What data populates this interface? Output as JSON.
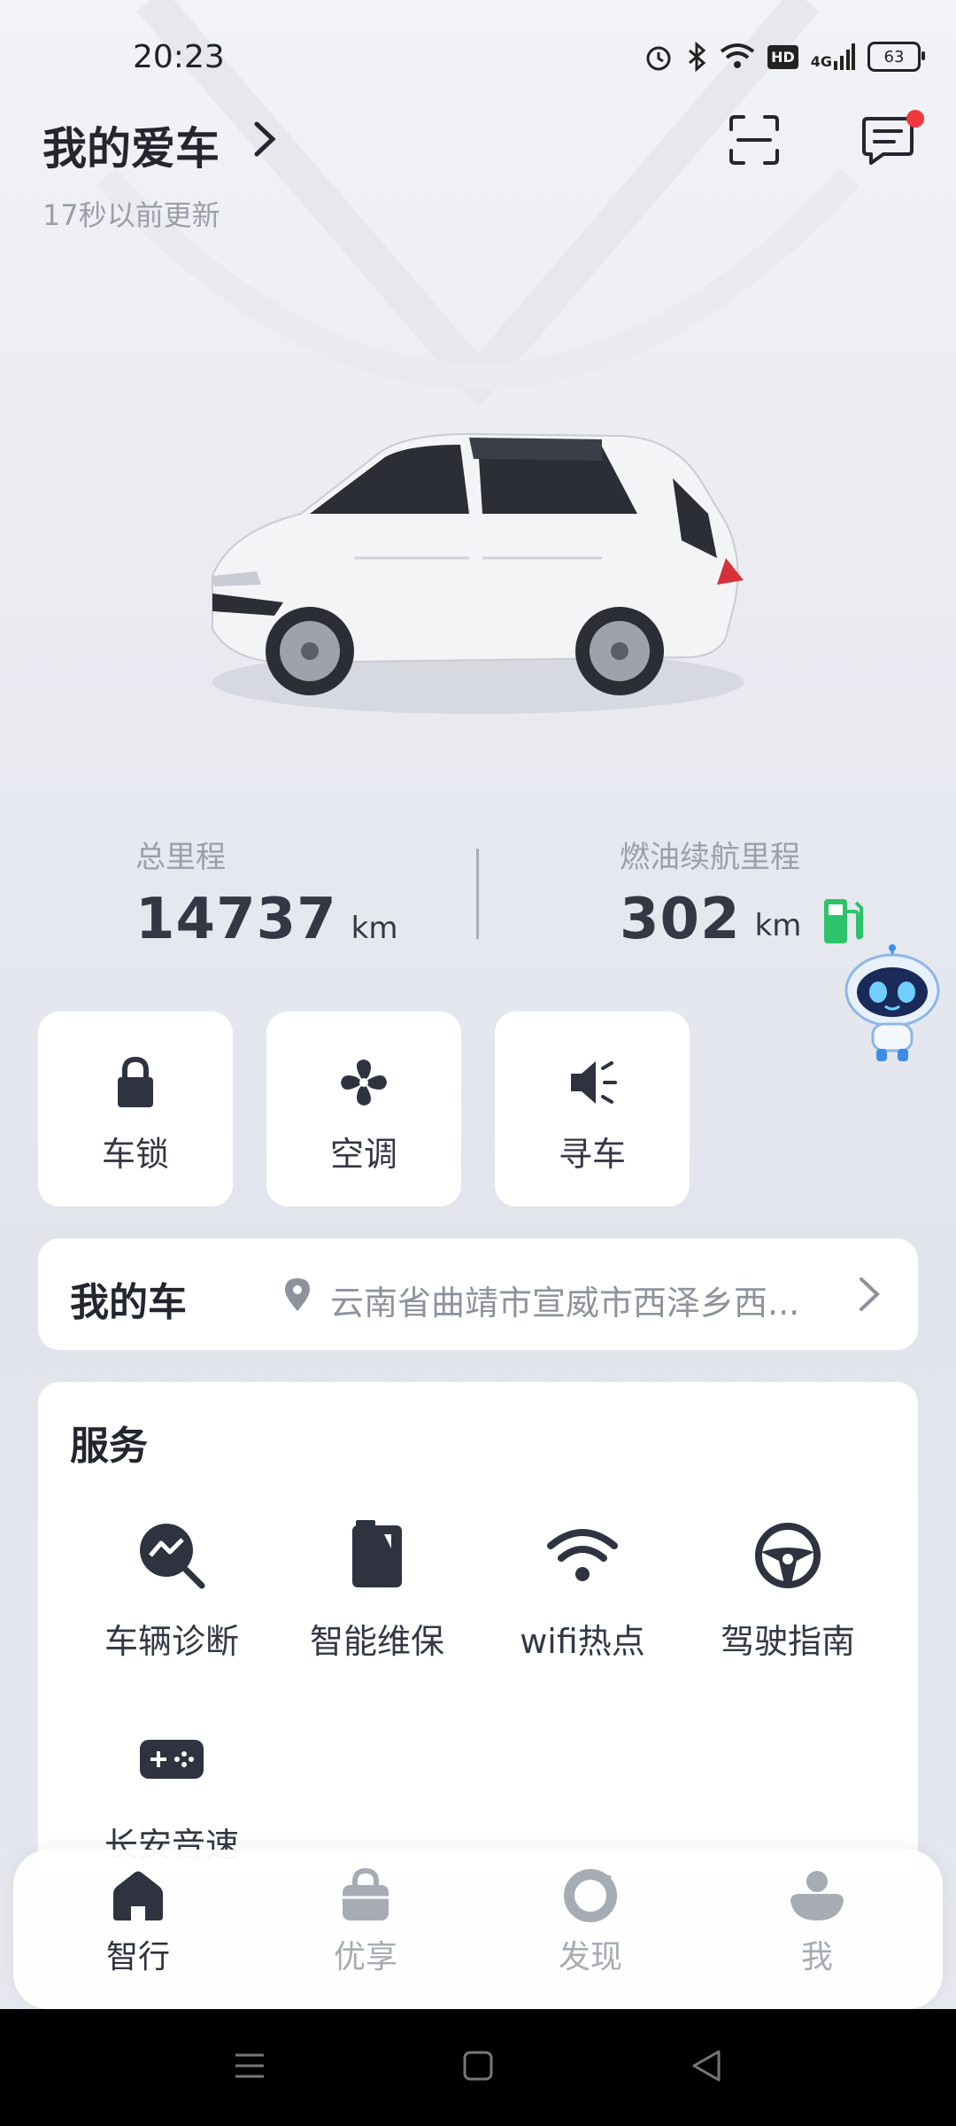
{
  "status_bar": {
    "time": "20:23",
    "battery": "63",
    "network": "4G",
    "hd": "HD"
  },
  "header": {
    "title": "我的爱车",
    "subtitle": "17秒以前更新"
  },
  "stats": {
    "total_mileage_label": "总里程",
    "total_mileage_value": "14737",
    "total_mileage_unit": "km",
    "fuel_range_label": "燃油续航里程",
    "fuel_range_value": "302",
    "fuel_range_unit": "km"
  },
  "quick_controls": [
    {
      "label": "车锁",
      "icon": "lock-icon"
    },
    {
      "label": "空调",
      "icon": "fan-icon"
    },
    {
      "label": "寻车",
      "icon": "speaker-icon"
    }
  ],
  "my_car": {
    "title": "我的车",
    "location": "云南省曲靖市宣威市西泽乡西..."
  },
  "services": {
    "title": "服务",
    "items": [
      {
        "label": "车辆诊断",
        "icon": "diagnosis-icon"
      },
      {
        "label": "智能维保",
        "icon": "maintenance-icon"
      },
      {
        "label": "wifi热点",
        "icon": "wifi-icon"
      },
      {
        "label": "驾驶指南",
        "icon": "steering-wheel-icon"
      },
      {
        "label": "长安音速",
        "icon": "gamepad-icon"
      }
    ]
  },
  "bottom_nav": [
    {
      "label": "智行",
      "icon": "home-icon",
      "active": true
    },
    {
      "label": "优享",
      "icon": "bag-icon",
      "active": false
    },
    {
      "label": "发现",
      "icon": "discover-icon",
      "active": false
    },
    {
      "label": "我",
      "icon": "person-icon",
      "active": false
    }
  ],
  "colors": {
    "active": "#2f3340",
    "inactive": "#a7abb3",
    "fuel_green": "#2dc36b",
    "badge_red": "#f0383e"
  }
}
